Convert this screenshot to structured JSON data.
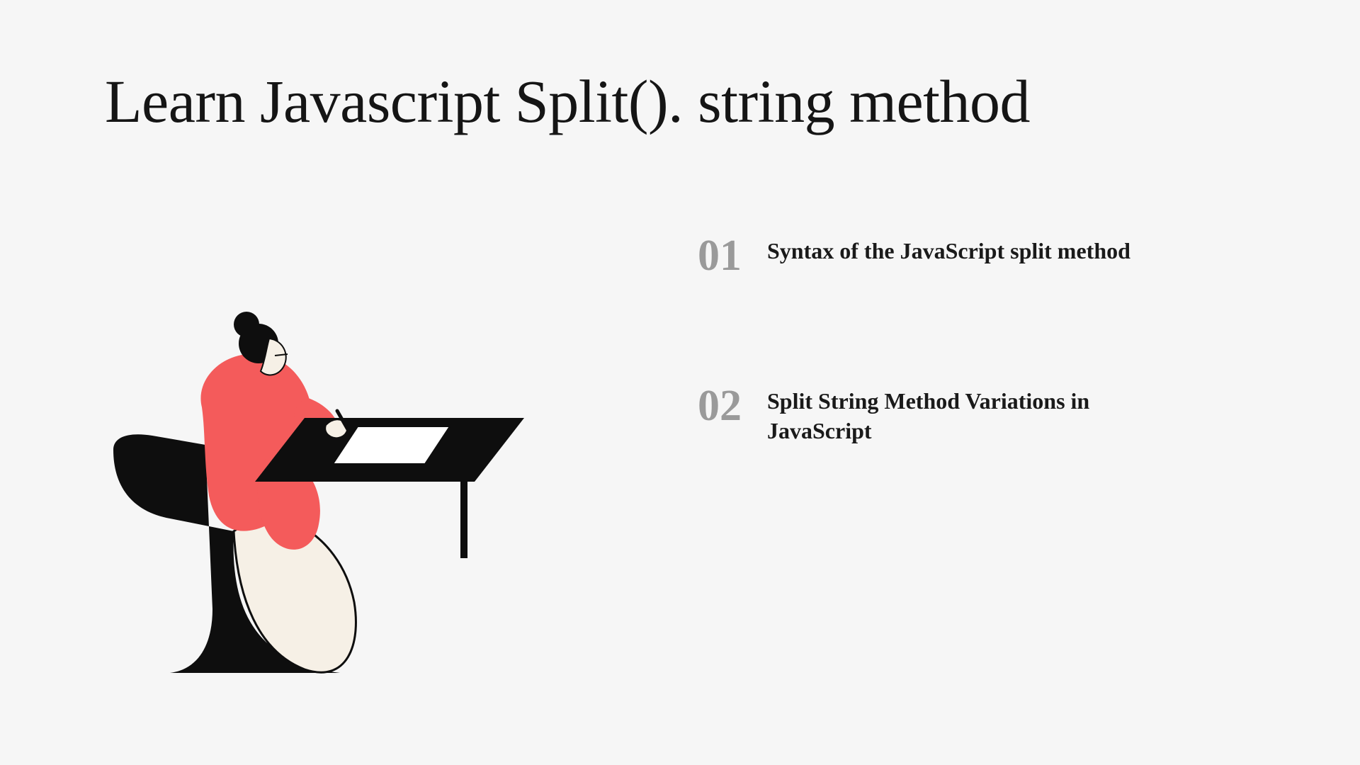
{
  "title": "Learn Javascript Split(). string method",
  "toc": [
    {
      "num": "01",
      "label": "Syntax of the JavaScript split method"
    },
    {
      "num": "02",
      "label": "Split String Method Variations in JavaScript"
    }
  ]
}
